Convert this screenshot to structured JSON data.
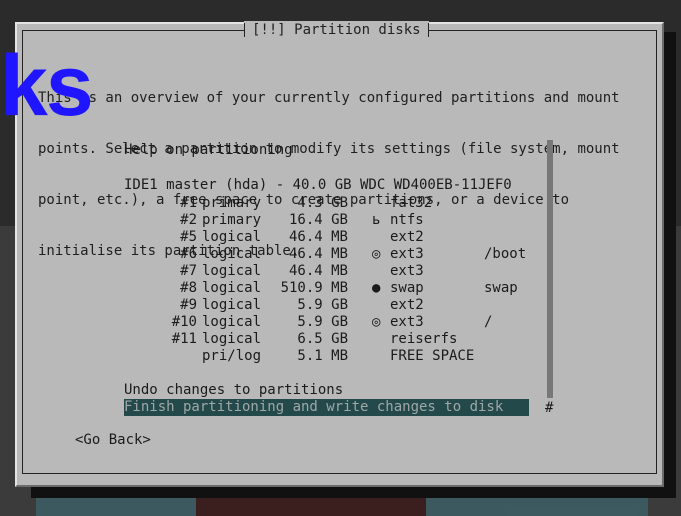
{
  "window": {
    "title": "[!!] Partition disks"
  },
  "intro_lines": [
    "This is an overview of your currently configured partitions and mount",
    "points. Select a partition to modify its settings (file system, mount",
    "point, etc.), a free space to create partitions, or a device to",
    "initialise its partition table."
  ],
  "menu": {
    "help": "Help on partitioning",
    "disk": "IDE1 master (hda) - 40.0 GB WDC WD400EB-11JEF0",
    "partitions": [
      {
        "number": "#1",
        "type": "primary",
        "size": "4.3 GB",
        "flag": "",
        "fs": "fat32",
        "mount": ""
      },
      {
        "number": "#2",
        "type": "primary",
        "size": "16.4 GB",
        "flag": "ь",
        "fs": "ntfs",
        "mount": ""
      },
      {
        "number": "#5",
        "type": "logical",
        "size": "46.4 MB",
        "flag": "",
        "fs": "ext2",
        "mount": ""
      },
      {
        "number": "#6",
        "type": "logical",
        "size": "46.4 MB",
        "flag": "◎",
        "fs": "ext3",
        "mount": "/boot"
      },
      {
        "number": "#7",
        "type": "logical",
        "size": "46.4 MB",
        "flag": "",
        "fs": "ext3",
        "mount": ""
      },
      {
        "number": "#8",
        "type": "logical",
        "size": "510.9 MB",
        "flag": "●",
        "fs": "swap",
        "mount": "swap"
      },
      {
        "number": "#9",
        "type": "logical",
        "size": "5.9 GB",
        "flag": "",
        "fs": "ext2",
        "mount": ""
      },
      {
        "number": "#10",
        "type": "logical",
        "size": "5.9 GB",
        "flag": "◎",
        "fs": "ext3",
        "mount": "/"
      },
      {
        "number": "#11",
        "type": "logical",
        "size": "6.5 GB",
        "flag": "",
        "fs": "reiserfs",
        "mount": ""
      },
      {
        "number": "",
        "type": "pri/log",
        "size": "5.1 MB",
        "flag": "",
        "fs": "FREE SPACE",
        "mount": ""
      }
    ],
    "undo": "Undo changes to partitions",
    "finish": "Finish partitioning and write changes to disk",
    "scroll_marker": "#"
  },
  "go_back": "<Go Back>",
  "overlay": {
    "text": "ks"
  }
}
